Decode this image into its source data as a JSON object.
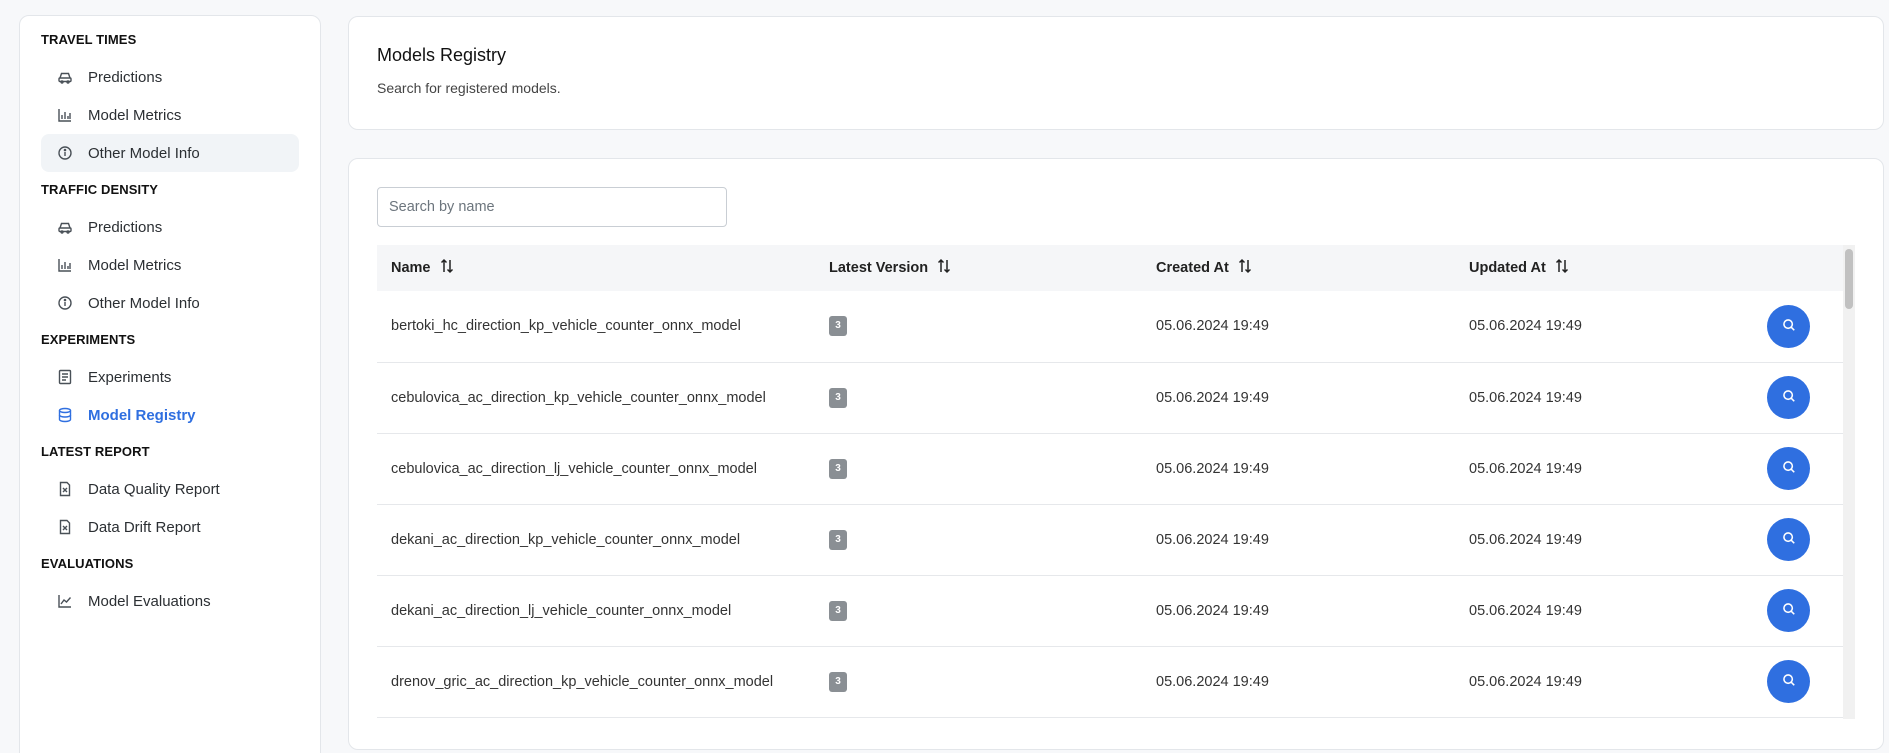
{
  "sidebar": {
    "sections": [
      {
        "title": "TRAVEL TIMES",
        "items": [
          {
            "label": "Predictions",
            "icon": "car-icon"
          },
          {
            "label": "Model Metrics",
            "icon": "bar-chart-icon"
          },
          {
            "label": "Other Model Info",
            "icon": "info-icon"
          }
        ]
      },
      {
        "title": "TRAFFIC DENSITY",
        "items": [
          {
            "label": "Predictions",
            "icon": "car-icon"
          },
          {
            "label": "Model Metrics",
            "icon": "bar-chart-icon"
          },
          {
            "label": "Other Model Info",
            "icon": "info-icon"
          }
        ]
      },
      {
        "title": "EXPERIMENTS",
        "items": [
          {
            "label": "Experiments",
            "icon": "list-icon"
          },
          {
            "label": "Model Registry",
            "icon": "database-icon"
          }
        ]
      },
      {
        "title": "LATEST REPORT",
        "items": [
          {
            "label": "Data Quality Report",
            "icon": "file-report-icon"
          },
          {
            "label": "Data Drift Report",
            "icon": "file-report-icon"
          }
        ]
      },
      {
        "title": "EVALUATIONS",
        "items": [
          {
            "label": "Model Evaluations",
            "icon": "line-chart-icon"
          }
        ]
      }
    ],
    "active_item": "Model Registry",
    "hover_item": "Other Model Info (Travel Times)"
  },
  "header": {
    "title": "Models Registry",
    "subtitle": "Search for registered models."
  },
  "search": {
    "placeholder": "Search by name",
    "value": ""
  },
  "table": {
    "columns": [
      "Name",
      "Latest Version",
      "Created At",
      "Updated At"
    ],
    "rows": [
      {
        "name": "bertoki_hc_direction_kp_vehicle_counter_onnx_model",
        "version": "3",
        "created": "05.06.2024 19:49",
        "updated": "05.06.2024 19:49"
      },
      {
        "name": "cebulovica_ac_direction_kp_vehicle_counter_onnx_model",
        "version": "3",
        "created": "05.06.2024 19:49",
        "updated": "05.06.2024 19:49"
      },
      {
        "name": "cebulovica_ac_direction_lj_vehicle_counter_onnx_model",
        "version": "3",
        "created": "05.06.2024 19:49",
        "updated": "05.06.2024 19:49"
      },
      {
        "name": "dekani_ac_direction_kp_vehicle_counter_onnx_model",
        "version": "3",
        "created": "05.06.2024 19:49",
        "updated": "05.06.2024 19:49"
      },
      {
        "name": "dekani_ac_direction_lj_vehicle_counter_onnx_model",
        "version": "3",
        "created": "05.06.2024 19:49",
        "updated": "05.06.2024 19:49"
      },
      {
        "name": "drenov_gric_ac_direction_kp_vehicle_counter_onnx_model",
        "version": "3",
        "created": "05.06.2024 19:49",
        "updated": "05.06.2024 19:49"
      }
    ]
  },
  "colors": {
    "accent": "#2f6fe0",
    "badge": "#8a8f94"
  }
}
